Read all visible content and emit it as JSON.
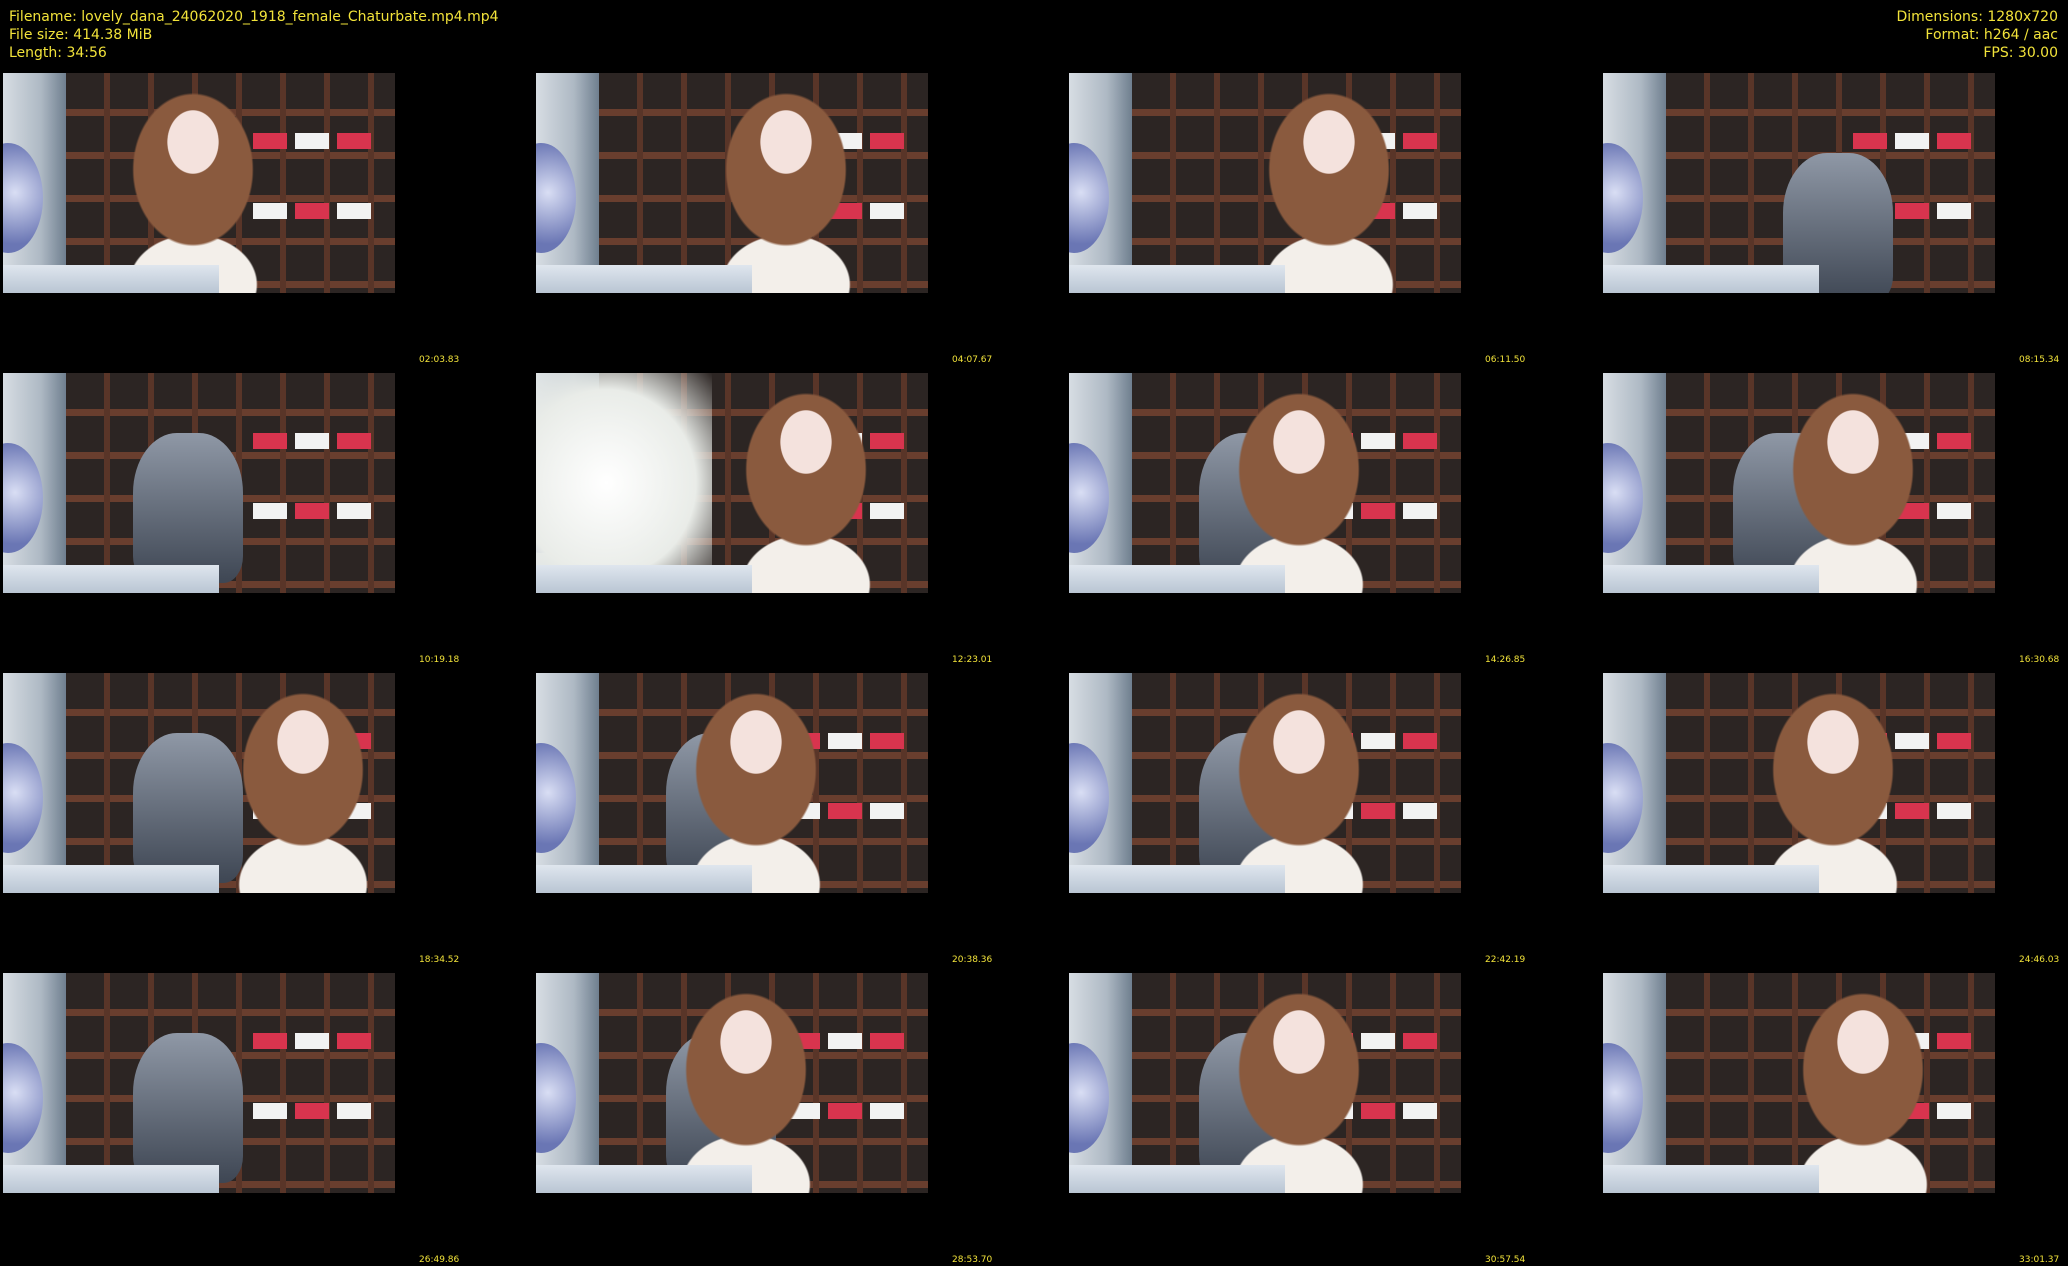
{
  "header": {
    "filename": "Filename: lovely_dana_24062020_1918_female_Chaturbate.mp4.mp4",
    "file_size": "File size: 414.38 MiB",
    "length": "Length: 34:56",
    "dimensions": "Dimensions: 1280x720",
    "format": "Format: h264 / aac",
    "fps": "FPS: 30.00"
  },
  "thumbnails": [
    {
      "timestamp": "02:03.83"
    },
    {
      "timestamp": "04:07.67"
    },
    {
      "timestamp": "06:11.50"
    },
    {
      "timestamp": "08:15.34"
    },
    {
      "timestamp": "10:19.18"
    },
    {
      "timestamp": "12:23.01"
    },
    {
      "timestamp": "14:26.85"
    },
    {
      "timestamp": "16:30.68"
    },
    {
      "timestamp": "18:34.52"
    },
    {
      "timestamp": "20:38.36"
    },
    {
      "timestamp": "22:42.19"
    },
    {
      "timestamp": "24:46.03"
    },
    {
      "timestamp": "26:49.86"
    },
    {
      "timestamp": "28:53.70"
    },
    {
      "timestamp": "30:57.54"
    },
    {
      "timestamp": "33:01.37"
    }
  ],
  "colors": {
    "background": "#000000",
    "text": "#f2e33a"
  }
}
